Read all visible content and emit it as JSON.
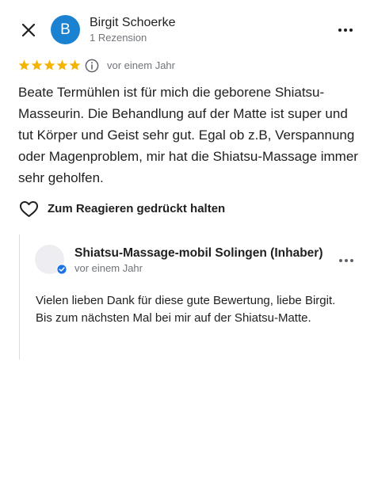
{
  "header": {
    "avatar_letter": "B",
    "reviewer_name": "Birgit Schoerke",
    "reviewer_meta": "1 Rezension",
    "avatar_color": "#1a82d0"
  },
  "review": {
    "rating": 5,
    "max_rating": 5,
    "star_color": "#f5b400",
    "date": "vor einem Jahr",
    "text": "Beate Termühlen ist für mich die geborene Shiatsu-Masseurin. Die Behandlung auf der Matte ist super und tut Körper und Geist sehr gut. Egal ob z.B, Verspannung oder Magenproblem, mir hat die Shiatsu-Massage immer sehr geholfen."
  },
  "reaction": {
    "label": "Zum Reagieren gedrückt halten"
  },
  "owner_reply": {
    "name": "Shiatsu-Massage-mobil Solingen (Inhaber)",
    "date": "vor einem Jahr",
    "text": "Vielen lieben Dank für diese gute Bewertung, liebe Birgit. Bis zum nächsten Mal bei mir auf der Shiatsu-Matte.",
    "verified_color": "#1a73e8"
  },
  "icons": [
    "close-icon",
    "more-vert-icon",
    "star-icon",
    "info-icon",
    "heart-icon",
    "verified-icon"
  ]
}
